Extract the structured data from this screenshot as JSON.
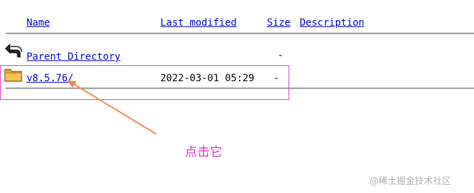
{
  "header": {
    "name_label": "Name",
    "last_modified_label": "Last modified",
    "size_label": "Size",
    "description_label": "Description"
  },
  "rows": [
    {
      "icon": "back-arrow-icon",
      "name": "Parent Directory",
      "last_modified": "",
      "size": "-",
      "description": ""
    },
    {
      "icon": "folder-icon",
      "name": "v8.5.76/",
      "last_modified": "2022-03-01 05:29",
      "size": "-",
      "description": ""
    }
  ],
  "annotation": {
    "text": "点击它",
    "color": "#d43cc4",
    "arrow_color": "#f08a4b"
  },
  "watermark": "@稀土掘金技术社区"
}
